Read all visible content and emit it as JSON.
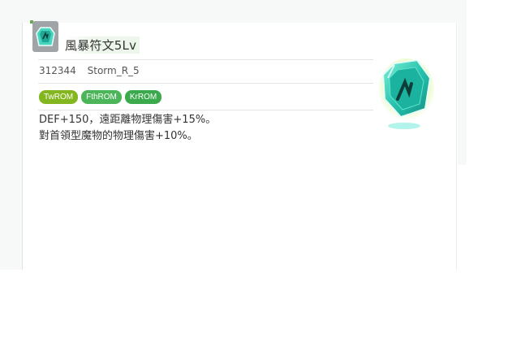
{
  "item": {
    "name": "風暴符文5Lv",
    "id": "312344",
    "code": "Storm_R_5",
    "tags": [
      "TwROM",
      "FthROM",
      "KrROM"
    ],
    "description": [
      "DEF+150，遠距離物理傷害+15%。",
      "對首領型魔物的物理傷害+10%。"
    ],
    "icon": "rune-crystal-icon"
  },
  "colors": {
    "tag_twrom": "#84b71f",
    "tag_fthrom": "#4cb55a",
    "tag_krrom": "#3aaa4c",
    "rune": "#2fc6b0"
  }
}
